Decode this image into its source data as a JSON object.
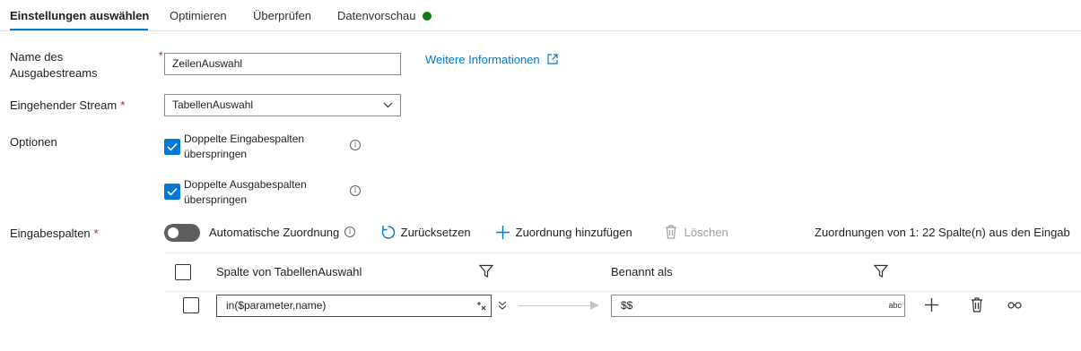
{
  "tabs": [
    {
      "label": "Einstellungen auswählen",
      "active": true
    },
    {
      "label": "Optimieren"
    },
    {
      "label": "Überprüfen"
    },
    {
      "label": "Datenvorschau",
      "status_color": "#107c10"
    }
  ],
  "form": {
    "output_stream": {
      "label": "Name des Ausgabestreams",
      "required_mark": "*",
      "value": "ZeilenAuswahl"
    },
    "more_info_link": "Weitere Informationen",
    "incoming_stream": {
      "label": "Eingehender Stream",
      "required_mark": "*",
      "value": "TabellenAuswahl"
    },
    "options": {
      "label": "Optionen",
      "skip_duplicate_input": {
        "label": "Doppelte Eingabespalten überspringen",
        "checked": true
      },
      "skip_duplicate_output": {
        "label": "Doppelte Ausgabespalten überspringen",
        "checked": true
      }
    },
    "input_columns": {
      "label": "Eingabespalten",
      "required_mark": "*"
    }
  },
  "toolbar": {
    "auto_mapping": {
      "label": "Automatische Zuordnung",
      "on": false
    },
    "reset": "Zurücksetzen",
    "add_mapping": "Zuordnung hinzufügen",
    "delete": "Löschen",
    "mapping_count": "Zuordnungen von 1: 22 Spalte(n) aus den Eingab"
  },
  "mapping_table": {
    "col_source": "Spalte von TabellenAuswahl",
    "col_target": "Benannt als",
    "rows": [
      {
        "source": "in($parameter,name)",
        "target": "$$",
        "target_type": "abc"
      }
    ]
  },
  "colors": {
    "accent": "#0078d4",
    "error": "#a4262c",
    "success": "#107c10"
  }
}
